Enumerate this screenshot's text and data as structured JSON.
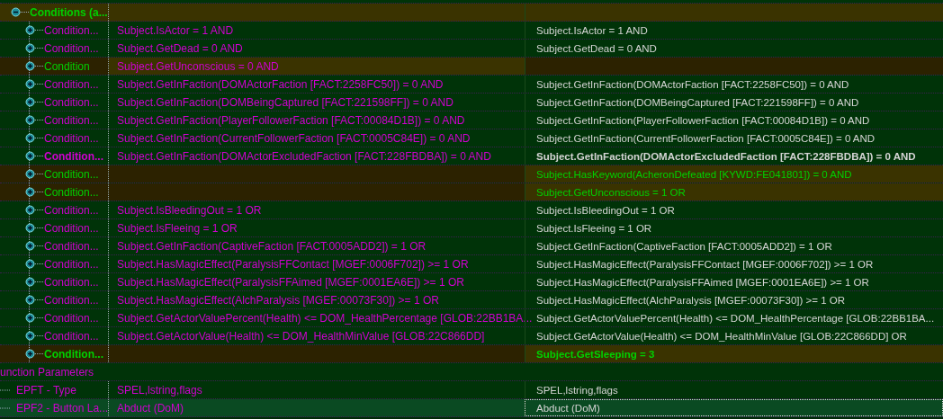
{
  "group": {
    "label": "Conditions (a...",
    "expanded": true
  },
  "conditions": [
    {
      "name": "Condition...",
      "kind": "override",
      "bold": false,
      "expanded": false,
      "left": "Subject.IsActor = 1 AND",
      "right": "Subject.IsActor = 1 AND"
    },
    {
      "name": "Condition...",
      "kind": "override",
      "bold": false,
      "expanded": false,
      "left": "Subject.GetDead = 0 AND",
      "right": "Subject.GetDead = 0 AND"
    },
    {
      "name": "Condition",
      "kind": "removed",
      "bold": false,
      "expanded": false,
      "left": "Subject.GetUnconscious = 0 AND"
    },
    {
      "name": "Condition...",
      "kind": "override",
      "bold": false,
      "expanded": false,
      "left": "Subject.GetInFaction(DOMActorFaction [FACT:2258FC50]) = 0 AND",
      "right": "Subject.GetInFaction(DOMActorFaction [FACT:2258FC50]) = 0 AND"
    },
    {
      "name": "Condition...",
      "kind": "override",
      "bold": false,
      "expanded": false,
      "left": "Subject.GetInFaction(DOMBeingCaptured [FACT:221598FF]) = 0 AND",
      "right": "Subject.GetInFaction(DOMBeingCaptured [FACT:221598FF]) = 0 AND"
    },
    {
      "name": "Condition...",
      "kind": "override",
      "bold": false,
      "expanded": false,
      "left": "Subject.GetInFaction(PlayerFollowerFaction [FACT:00084D1B]) = 0 AND",
      "right": "Subject.GetInFaction(PlayerFollowerFaction [FACT:00084D1B]) = 0 AND"
    },
    {
      "name": "Condition...",
      "kind": "override",
      "bold": false,
      "expanded": false,
      "left": "Subject.GetInFaction(CurrentFollowerFaction [FACT:0005C84E]) = 0 AND",
      "right": "Subject.GetInFaction(CurrentFollowerFaction [FACT:0005C84E]) = 0 AND"
    },
    {
      "name": "Condition...",
      "kind": "override",
      "bold": true,
      "expanded": false,
      "left": "Subject.GetInFaction(DOMActorExcludedFaction [FACT:228FBDBA]) = 0 AND",
      "right": "Subject.GetInFaction(DOMActorExcludedFaction [FACT:228FBDBA]) = 0 AND"
    },
    {
      "name": "Condition...",
      "kind": "added",
      "bold": false,
      "expanded": false,
      "right": "Subject.HasKeyword(AcheronDefeated [KYWD:FE041801]) = 0 AND"
    },
    {
      "name": "Condition...",
      "kind": "added",
      "bold": false,
      "expanded": false,
      "right": "Subject.GetUnconscious = 1 OR"
    },
    {
      "name": "Condition...",
      "kind": "override",
      "bold": false,
      "expanded": false,
      "left": "Subject.IsBleedingOut = 1 OR",
      "right": "Subject.IsBleedingOut = 1 OR"
    },
    {
      "name": "Condition...",
      "kind": "override",
      "bold": false,
      "expanded": false,
      "left": "Subject.IsFleeing = 1 OR",
      "right": "Subject.IsFleeing = 1 OR"
    },
    {
      "name": "Condition...",
      "kind": "override",
      "bold": false,
      "expanded": false,
      "left": "Subject.GetInFaction(CaptiveFaction [FACT:0005ADD2]) = 1 OR",
      "right": "Subject.GetInFaction(CaptiveFaction [FACT:0005ADD2]) = 1 OR"
    },
    {
      "name": "Condition...",
      "kind": "override",
      "bold": false,
      "expanded": false,
      "left": "Subject.HasMagicEffect(ParalysisFFContact [MGEF:0006F702]) >= 1 OR",
      "right": "Subject.HasMagicEffect(ParalysisFFContact [MGEF:0006F702]) >= 1 OR"
    },
    {
      "name": "Condition...",
      "kind": "override",
      "bold": false,
      "expanded": false,
      "left": "Subject.HasMagicEffect(ParalysisFFAimed [MGEF:0001EA6E]) >= 1 OR",
      "right": "Subject.HasMagicEffect(ParalysisFFAimed [MGEF:0001EA6E]) >= 1 OR"
    },
    {
      "name": "Condition...",
      "kind": "override",
      "bold": false,
      "expanded": false,
      "left": "Subject.HasMagicEffect(AlchParalysis [MGEF:00073F30]) >= 1 OR",
      "right": "Subject.HasMagicEffect(AlchParalysis [MGEF:00073F30]) >= 1 OR"
    },
    {
      "name": "Condition...",
      "kind": "override",
      "bold": false,
      "expanded": false,
      "left": "Subject.GetActorValuePercent(Health) <= DOM_HealthPercentage [GLOB:22BB1BA...",
      "right": "Subject.GetActorValuePercent(Health) <= DOM_HealthPercentage [GLOB:22BB1BA..."
    },
    {
      "name": "Condition...",
      "kind": "override",
      "bold": false,
      "expanded": false,
      "left": "Subject.GetActorValue(Health) <= DOM_HealthMinValue [GLOB:22C866DD]",
      "right": "Subject.GetActorValue(Health) <= DOM_HealthMinValue [GLOB:22C866DD] OR"
    },
    {
      "name": "Condition...",
      "kind": "added",
      "bold": true,
      "expanded": false,
      "right": "Subject.GetSleeping = 3"
    }
  ],
  "section": {
    "label": "unction Parameters"
  },
  "parameters": [
    {
      "name": "EPFT - Type",
      "selected": false,
      "left": "SPEL,lstring,flags",
      "right": "SPEL,lstring,flags"
    },
    {
      "name": "EPF2 - Button La...",
      "selected": true,
      "left": "Abduct (DoM)",
      "right": "Abduct (DoM)"
    }
  ]
}
